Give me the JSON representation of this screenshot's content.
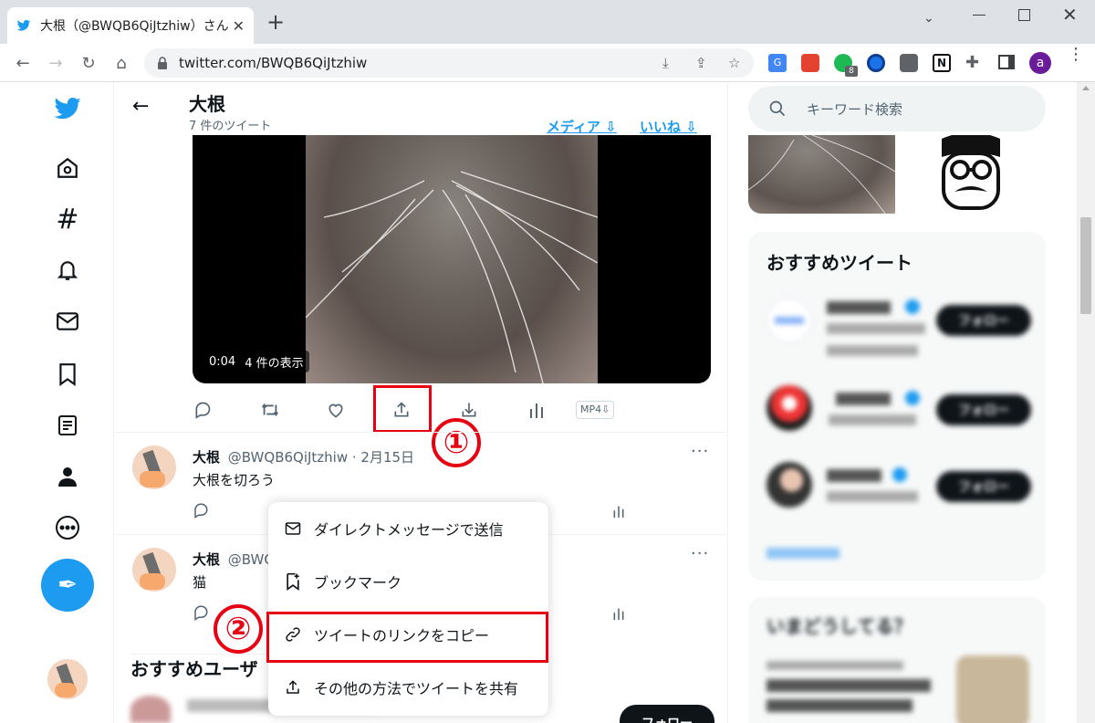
{
  "browser": {
    "tab_title": "大根（@BWQB6QiJtzhiw）さん /",
    "url": "twitter.com/BWQB6QiJtzhiw",
    "extension_badge": "8",
    "profile_initial": "a"
  },
  "header": {
    "title": "大根",
    "tweet_count": "7 件のツイート",
    "tab_media": "メディア ⇩",
    "tab_likes": "いいね ⇩"
  },
  "video": {
    "time": "0:04",
    "views": "4 件の表示"
  },
  "actions": {
    "mp4_label": "MP4⇩"
  },
  "tweets": [
    {
      "name": "大根",
      "handle": "@BWQB6QiJtzhiw · 2月15日",
      "text": "大根を切ろう"
    },
    {
      "name": "大根",
      "handle": "@BWQ",
      "text": "猫"
    }
  ],
  "share_menu": {
    "items": [
      {
        "label": "ダイレクトメッセージで送信"
      },
      {
        "label": "ブックマーク"
      },
      {
        "label": "ツイートのリンクをコピー"
      },
      {
        "label": "その他の方法でツイートを共有"
      }
    ]
  },
  "annotations": {
    "step1": "①",
    "step2": "②",
    "highlight_color": "#e60012"
  },
  "sidebar": {
    "search_placeholder": "キーワード検索",
    "recommended_title": "おすすめツイート",
    "trends_title": "いまどうしてる？"
  },
  "bottom": {
    "who_to_follow": "おすすめユーザ",
    "follow_label": "フォロー"
  },
  "colors": {
    "twitter_blue": "#1d9bf0",
    "text": "#0f1419",
    "muted": "#536471"
  }
}
